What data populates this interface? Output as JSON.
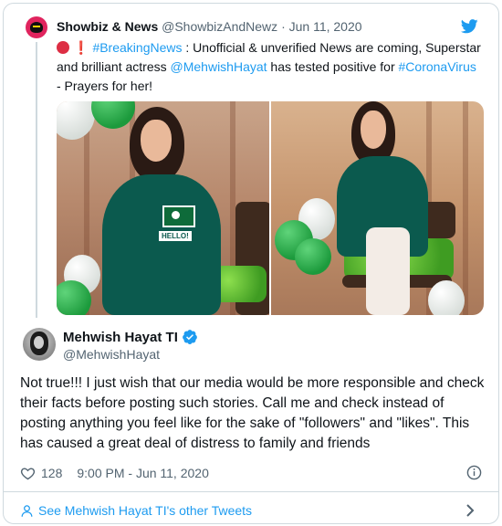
{
  "quoted": {
    "name": "Showbiz & News",
    "handle": "@ShowbizAndNewz",
    "separator": " · ",
    "date": "Jun 11, 2020",
    "text_prefix": "❗",
    "hashtag_breaking": "#BreakingNews",
    "text_part1": " : Unofficial & unverified News are coming, Superstar and brilliant actress ",
    "mention": "@MehwishHayat",
    "text_part2": " has tested positive for ",
    "hashtag_corona": "#CoronaVirus",
    "text_part3": " - Prayers for her!",
    "flag_label": "HELLO!"
  },
  "tweet": {
    "name": "Mehwish Hayat TI",
    "handle": "@MehwishHayat",
    "text": "Not true!!! I just wish that our media would be more responsible and check their facts before posting such stories. Call me and check instead of posting anything you feel like for the sake of \"followers\" and \"likes\". This has caused a great deal of distress to family and friends",
    "likes": "128",
    "timestamp": "9:00 PM - Jun 11, 2020"
  },
  "footer": {
    "label": "See Mehwish Hayat TI's other Tweets"
  },
  "colors": {
    "accent": "#1d9bf0",
    "text": "#0f1419",
    "muted": "#536471",
    "border": "#cfd9de"
  },
  "icons": [
    "twitter-bird-icon",
    "verified-badge-icon",
    "heart-icon",
    "info-icon",
    "person-icon",
    "chevron-right-icon"
  ]
}
